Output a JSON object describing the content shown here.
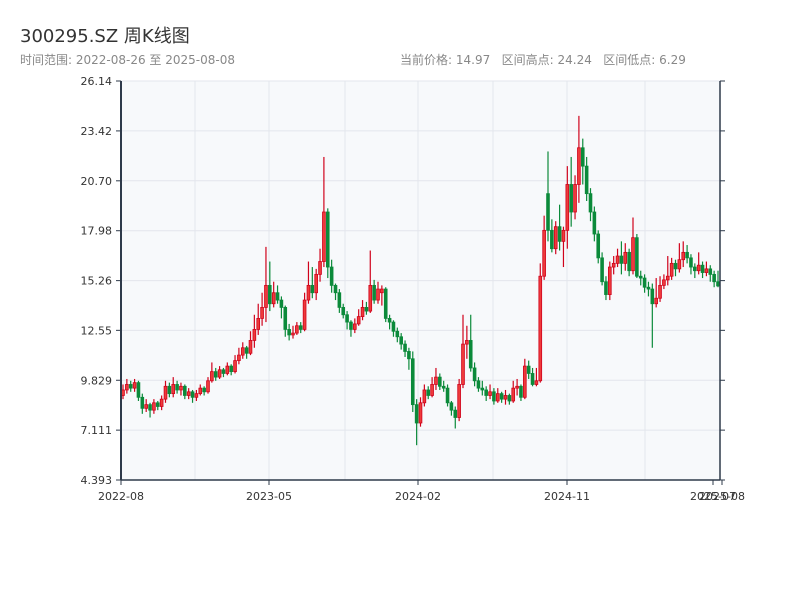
{
  "header": {
    "title": "300295.SZ 周K线图",
    "range_text": "时间范围: 2022-08-26 至 2025-08-08",
    "stats_text": "当前价格: 14.97   区间高点: 24.24   区间低点: 6.29"
  },
  "colors": {
    "up": "#d0021b",
    "up_fill": "#ee3b3b",
    "down": "#0b8a3a",
    "plot_bg": "#f7f9fb",
    "grid": "#e3e6ec",
    "axis": "#2e3a4a"
  },
  "chart_data": {
    "type": "candlestick",
    "title": "300295.SZ 周K线图",
    "ylim": [
      4.393,
      26.14
    ],
    "yticks": [
      "4.393",
      "7.111",
      "9.829",
      "12.55",
      "15.26",
      "17.98",
      "20.70",
      "23.42",
      "26.14"
    ],
    "xticks": [
      "2022-08",
      "2023-05",
      "2024-02",
      "2024-11",
      "2025-07",
      "2025-08"
    ],
    "grid": true,
    "ohlc": [
      [
        9.0,
        9.6,
        8.8,
        9.3
      ],
      [
        9.3,
        9.9,
        9.1,
        9.6
      ],
      [
        9.6,
        9.8,
        9.2,
        9.4
      ],
      [
        9.4,
        9.9,
        9.2,
        9.7
      ],
      [
        9.7,
        9.8,
        8.7,
        8.9
      ],
      [
        8.9,
        9.1,
        8.0,
        8.3
      ],
      [
        8.3,
        8.8,
        8.1,
        8.5
      ],
      [
        8.5,
        8.6,
        7.8,
        8.2
      ],
      [
        8.2,
        8.8,
        8.0,
        8.6
      ],
      [
        8.6,
        8.7,
        8.2,
        8.4
      ],
      [
        8.4,
        9.0,
        8.2,
        8.8
      ],
      [
        8.8,
        9.8,
        8.6,
        9.5
      ],
      [
        9.5,
        9.7,
        8.9,
        9.1
      ],
      [
        9.1,
        10.0,
        8.9,
        9.6
      ],
      [
        9.6,
        9.8,
        9.1,
        9.3
      ],
      [
        9.3,
        9.7,
        9.0,
        9.5
      ],
      [
        9.5,
        9.6,
        8.8,
        9.0
      ],
      [
        9.0,
        9.4,
        8.8,
        9.2
      ],
      [
        9.2,
        9.3,
        8.6,
        8.9
      ],
      [
        8.9,
        9.3,
        8.7,
        9.1
      ],
      [
        9.1,
        9.6,
        9.0,
        9.4
      ],
      [
        9.4,
        9.5,
        9.0,
        9.2
      ],
      [
        9.2,
        10.0,
        9.1,
        9.8
      ],
      [
        9.8,
        10.8,
        9.7,
        10.3
      ],
      [
        10.3,
        10.5,
        9.8,
        10.0
      ],
      [
        10.0,
        10.6,
        9.9,
        10.4
      ],
      [
        10.4,
        10.5,
        10.0,
        10.2
      ],
      [
        10.2,
        10.8,
        10.1,
        10.6
      ],
      [
        10.6,
        10.7,
        10.1,
        10.3
      ],
      [
        10.3,
        11.2,
        10.2,
        10.9
      ],
      [
        10.9,
        11.6,
        10.7,
        11.2
      ],
      [
        11.2,
        11.9,
        11.0,
        11.6
      ],
      [
        11.6,
        11.7,
        11.0,
        11.3
      ],
      [
        11.3,
        12.5,
        11.2,
        12.0
      ],
      [
        12.0,
        13.4,
        11.6,
        12.6
      ],
      [
        12.6,
        14.0,
        12.3,
        13.2
      ],
      [
        13.2,
        14.6,
        12.8,
        13.8
      ],
      [
        13.8,
        17.1,
        13.0,
        15.0
      ],
      [
        15.0,
        16.3,
        13.6,
        14.0
      ],
      [
        14.0,
        15.2,
        13.8,
        14.6
      ],
      [
        14.6,
        15.0,
        14.0,
        14.2
      ],
      [
        14.2,
        14.4,
        13.2,
        13.8
      ],
      [
        13.8,
        13.9,
        12.2,
        12.6
      ],
      [
        12.6,
        12.9,
        12.0,
        12.3
      ],
      [
        12.3,
        12.8,
        12.1,
        12.4
      ],
      [
        12.4,
        13.0,
        12.3,
        12.8
      ],
      [
        12.8,
        13.0,
        12.4,
        12.6
      ],
      [
        12.6,
        14.6,
        12.5,
        14.2
      ],
      [
        14.2,
        16.3,
        14.0,
        15.0
      ],
      [
        15.0,
        16.0,
        14.3,
        14.6
      ],
      [
        14.6,
        15.9,
        14.2,
        15.6
      ],
      [
        15.6,
        17.0,
        15.2,
        16.3
      ],
      [
        16.3,
        22.0,
        16.0,
        19.0
      ],
      [
        19.0,
        19.2,
        15.4,
        16.0
      ],
      [
        16.0,
        16.4,
        14.6,
        15.0
      ],
      [
        15.0,
        15.1,
        14.2,
        14.6
      ],
      [
        14.6,
        14.8,
        13.5,
        13.8
      ],
      [
        13.8,
        14.0,
        13.2,
        13.4
      ],
      [
        13.4,
        13.6,
        12.6,
        13.0
      ],
      [
        13.0,
        13.1,
        12.2,
        12.6
      ],
      [
        12.6,
        13.2,
        12.4,
        12.9
      ],
      [
        12.9,
        13.7,
        12.8,
        13.3
      ],
      [
        13.3,
        14.2,
        13.1,
        13.8
      ],
      [
        13.8,
        14.1,
        13.4,
        13.6
      ],
      [
        13.6,
        16.9,
        13.5,
        15.0
      ],
      [
        15.0,
        15.3,
        14.0,
        14.2
      ],
      [
        14.2,
        15.2,
        14.0,
        14.8
      ],
      [
        14.6,
        15.0,
        13.9,
        14.8
      ],
      [
        14.8,
        14.9,
        13.0,
        13.2
      ],
      [
        13.2,
        13.4,
        12.6,
        13.0
      ],
      [
        13.0,
        13.1,
        12.2,
        12.5
      ],
      [
        12.5,
        12.7,
        11.9,
        12.2
      ],
      [
        12.2,
        12.4,
        11.5,
        11.8
      ],
      [
        11.8,
        12.0,
        11.1,
        11.4
      ],
      [
        11.4,
        11.6,
        10.4,
        11.0
      ],
      [
        11.0,
        11.4,
        8.1,
        8.5
      ],
      [
        8.5,
        8.8,
        6.29,
        7.5
      ],
      [
        7.5,
        8.9,
        7.3,
        8.6
      ],
      [
        8.6,
        9.6,
        8.4,
        9.3
      ],
      [
        9.3,
        9.5,
        8.8,
        9.0
      ],
      [
        9.0,
        10.0,
        8.9,
        9.6
      ],
      [
        9.6,
        10.5,
        9.3,
        10.0
      ],
      [
        10.0,
        10.2,
        9.3,
        9.5
      ],
      [
        9.5,
        9.8,
        9.2,
        9.4
      ],
      [
        9.4,
        9.6,
        8.4,
        8.6
      ],
      [
        8.6,
        8.7,
        7.9,
        8.2
      ],
      [
        8.2,
        8.4,
        7.2,
        7.8
      ],
      [
        7.8,
        9.9,
        7.6,
        9.6
      ],
      [
        9.6,
        13.4,
        9.4,
        11.8
      ],
      [
        11.8,
        12.8,
        11.0,
        12.0
      ],
      [
        12.0,
        13.4,
        10.3,
        10.5
      ],
      [
        10.5,
        10.8,
        9.5,
        9.8
      ],
      [
        9.8,
        10.0,
        9.2,
        9.4
      ],
      [
        9.4,
        9.8,
        9.0,
        9.3
      ],
      [
        9.3,
        9.5,
        8.7,
        9.0
      ],
      [
        9.0,
        9.6,
        8.8,
        9.2
      ],
      [
        9.2,
        9.4,
        8.5,
        8.7
      ],
      [
        8.7,
        9.4,
        8.6,
        9.1
      ],
      [
        9.1,
        9.2,
        8.6,
        8.8
      ],
      [
        8.8,
        9.3,
        8.5,
        9.0
      ],
      [
        9.0,
        9.1,
        8.5,
        8.7
      ],
      [
        8.7,
        9.8,
        8.6,
        9.4
      ],
      [
        9.4,
        9.9,
        9.0,
        9.5
      ],
      [
        9.5,
        9.6,
        8.7,
        8.9
      ],
      [
        8.9,
        11.0,
        8.8,
        10.6
      ],
      [
        10.6,
        10.9,
        9.9,
        10.2
      ],
      [
        10.2,
        10.5,
        9.5,
        9.6
      ],
      [
        9.6,
        10.5,
        9.5,
        9.8
      ],
      [
        9.8,
        16.2,
        9.7,
        15.5
      ],
      [
        15.5,
        18.8,
        15.3,
        18.0
      ],
      [
        20.0,
        22.3,
        17.4,
        18.0
      ],
      [
        18.0,
        18.6,
        16.8,
        17.0
      ],
      [
        17.0,
        18.5,
        16.7,
        18.2
      ],
      [
        18.2,
        19.4,
        16.9,
        17.4
      ],
      [
        17.4,
        18.2,
        16.0,
        18.0
      ],
      [
        18.0,
        21.5,
        17.0,
        20.5
      ],
      [
        20.5,
        22.0,
        18.2,
        19.0
      ],
      [
        19.0,
        21.0,
        18.6,
        20.5
      ],
      [
        20.5,
        24.24,
        19.5,
        22.5
      ],
      [
        22.5,
        23.0,
        20.5,
        21.5
      ],
      [
        21.5,
        22.0,
        19.6,
        20.0
      ],
      [
        20.0,
        20.3,
        18.5,
        19.0
      ],
      [
        19.0,
        19.3,
        17.4,
        17.8
      ],
      [
        17.8,
        18.0,
        16.2,
        16.5
      ],
      [
        16.5,
        16.8,
        15.0,
        15.2
      ],
      [
        15.2,
        15.5,
        14.2,
        14.5
      ],
      [
        14.5,
        16.3,
        14.2,
        16.0
      ],
      [
        16.0,
        16.6,
        15.6,
        16.2
      ],
      [
        16.2,
        17.0,
        16.0,
        16.6
      ],
      [
        16.6,
        17.4,
        15.6,
        16.2
      ],
      [
        16.2,
        17.3,
        15.8,
        16.8
      ],
      [
        16.8,
        17.0,
        15.5,
        15.8
      ],
      [
        15.8,
        18.7,
        15.6,
        17.6
      ],
      [
        17.6,
        17.8,
        15.4,
        15.5
      ],
      [
        15.5,
        15.8,
        15.0,
        15.4
      ],
      [
        15.4,
        15.6,
        14.6,
        14.9
      ],
      [
        14.9,
        15.2,
        14.4,
        14.8
      ],
      [
        14.8,
        15.1,
        11.6,
        14.0
      ],
      [
        14.0,
        15.4,
        13.8,
        14.3
      ],
      [
        14.3,
        15.5,
        14.1,
        15.0
      ],
      [
        15.0,
        15.6,
        14.8,
        15.3
      ],
      [
        15.3,
        16.6,
        15.0,
        15.5
      ],
      [
        15.5,
        16.5,
        15.3,
        16.2
      ],
      [
        16.2,
        16.4,
        15.5,
        15.9
      ],
      [
        15.9,
        17.3,
        15.7,
        16.4
      ],
      [
        16.4,
        17.4,
        16.0,
        16.8
      ],
      [
        16.8,
        17.2,
        16.2,
        16.5
      ],
      [
        16.5,
        16.7,
        15.6,
        16.0
      ],
      [
        16.0,
        16.2,
        15.4,
        15.8
      ],
      [
        15.8,
        16.8,
        15.6,
        16.1
      ],
      [
        16.1,
        16.3,
        15.4,
        15.7
      ],
      [
        15.7,
        16.3,
        15.5,
        15.9
      ],
      [
        15.9,
        16.1,
        15.2,
        15.6
      ],
      [
        15.6,
        15.8,
        14.9,
        15.2
      ],
      [
        15.2,
        15.8,
        14.9,
        14.97
      ]
    ]
  }
}
